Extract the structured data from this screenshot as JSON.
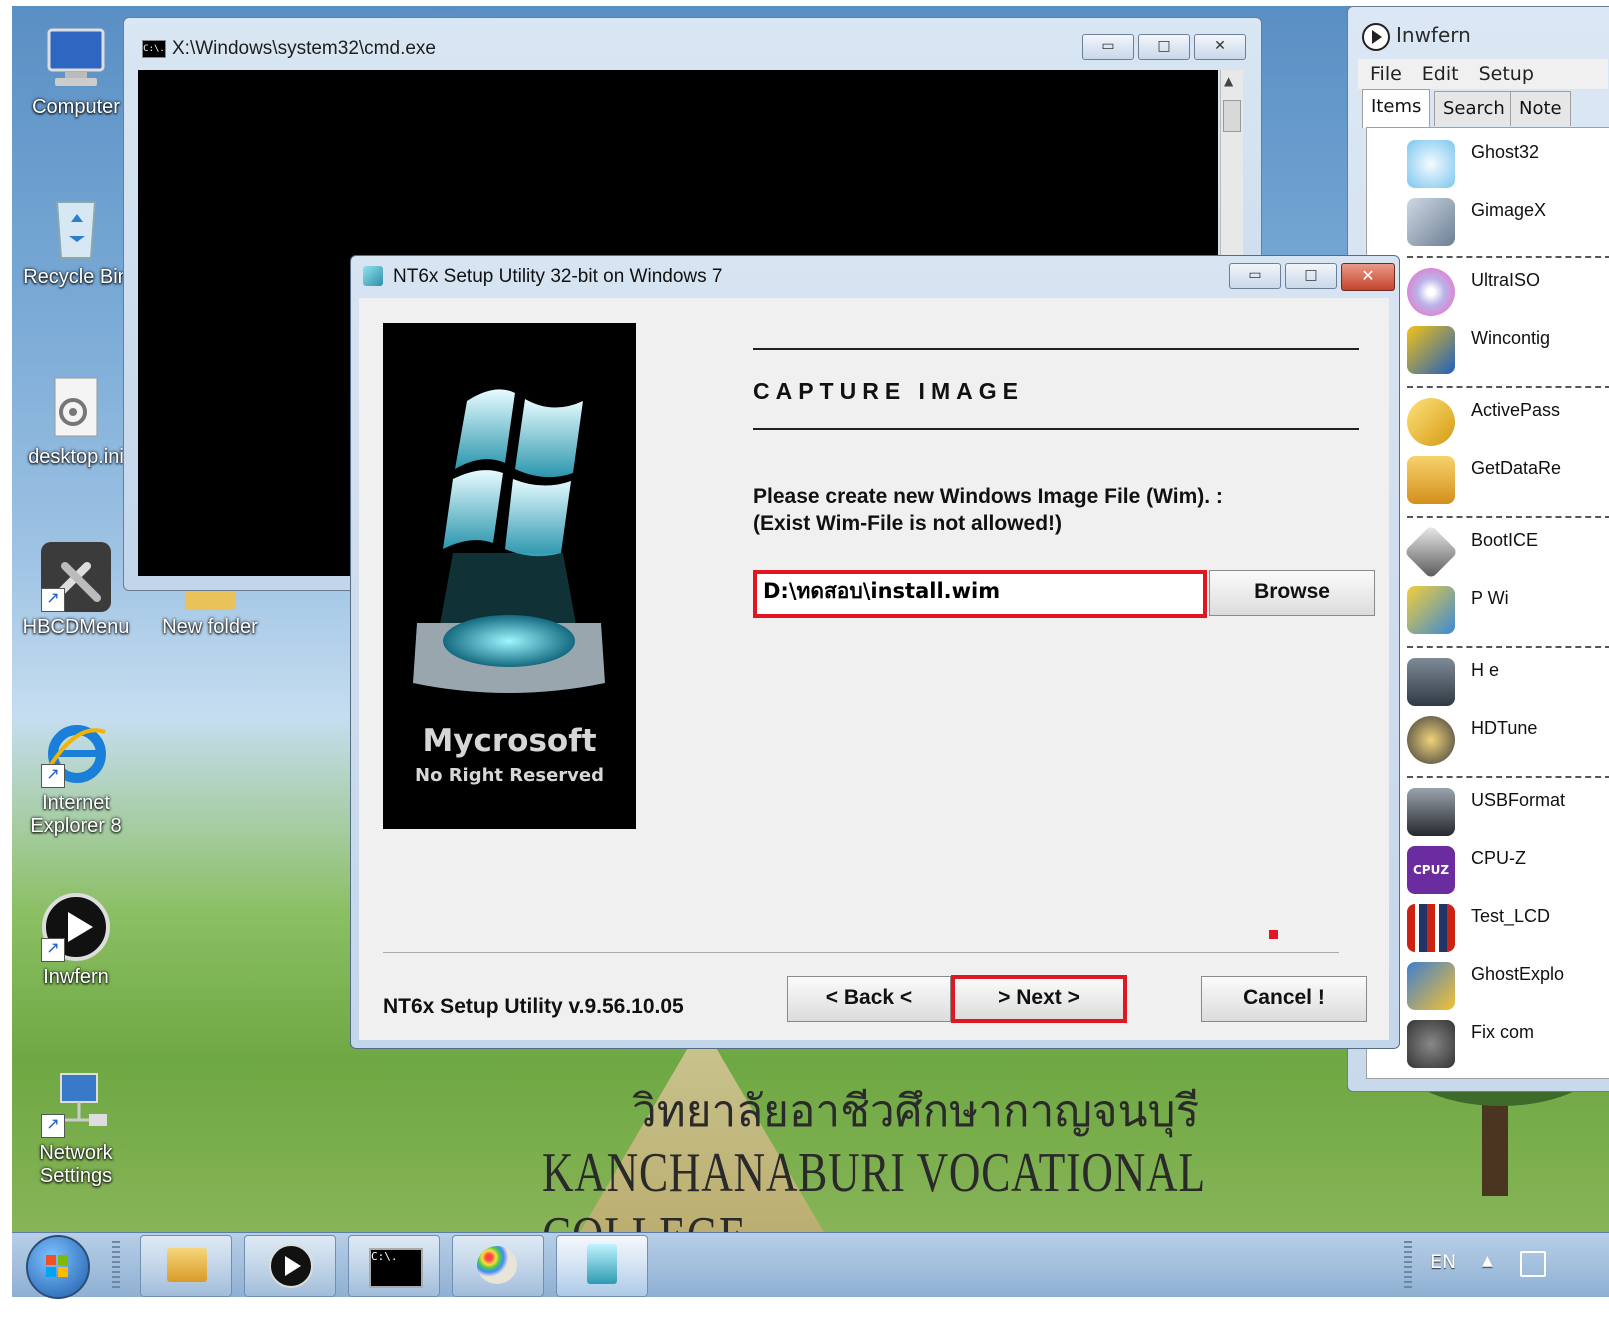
{
  "desktop": {
    "icons": [
      {
        "label": "Computer",
        "label2": ""
      },
      {
        "label": "Recycle Bin",
        "label2": ""
      },
      {
        "label": "desktop.ini",
        "label2": ""
      },
      {
        "label": "HBCDMenu",
        "label2": ""
      },
      {
        "label": "New folder",
        "label2": ""
      },
      {
        "label": "Internet",
        "label2": "Explorer 8"
      },
      {
        "label": "Inwfern",
        "label2": ""
      },
      {
        "label": "Network",
        "label2": "Settings"
      }
    ],
    "wallpaper_text_thai": "วิทยาลัยอาชีวศึกษากาญจนบุรี",
    "wallpaper_text_en": "KANCHANABURI VOCATIONAL COLLEGE"
  },
  "cmd_window": {
    "title": "X:\\Windows\\system32\\cmd.exe",
    "icon_text": "C:\\."
  },
  "inwfern": {
    "title": "Inwfern",
    "menu": [
      "File",
      "Edit",
      "Setup"
    ],
    "tabs": [
      "Items",
      "Search",
      "Note"
    ],
    "items": [
      "Ghost32",
      "GimageX",
      "UltraISO",
      "Wincontig",
      "ActivePass",
      "GetDataRe",
      "BootICE",
      "P          Wi",
      "H            e",
      "HDTune",
      "USBFormat",
      "CPU-Z",
      "Test_LCD",
      "GhostExplo",
      "Fix com"
    ]
  },
  "nt6x": {
    "title": "NT6x Setup Utility 32-bit on Windows 7",
    "brand": "Mycrosoft",
    "tagline": "No Right Reserved",
    "heading": "CAPTURE   IMAGE",
    "instruction_line1": "Please create new Windows Image File (Wim). :",
    "instruction_line2": "(Exist Wim-File is not allowed!)",
    "path_value": "D:\\ทดสอบ\\install.wim",
    "browse_label": "Browse",
    "version": "NT6x Setup Utility v.9.56.10.05",
    "back_label": "< Back <",
    "next_label": "> Next >",
    "cancel_label": "Cancel !"
  },
  "taskbar": {
    "language": "EN"
  },
  "colors": {
    "highlight_red": "#e01622",
    "window_chrome": "#c4d6ea"
  }
}
